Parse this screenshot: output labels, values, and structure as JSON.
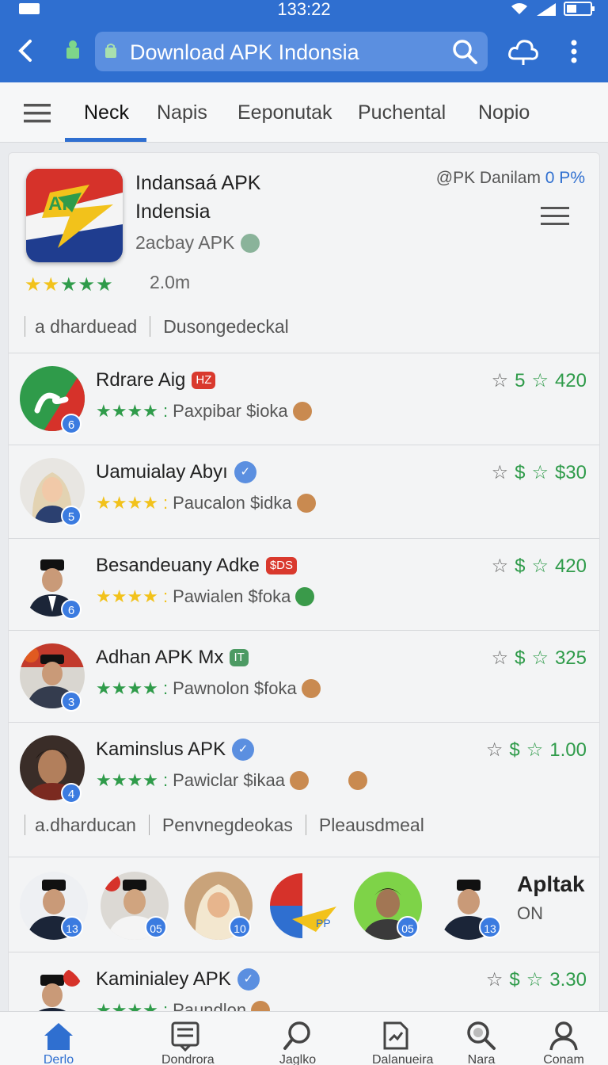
{
  "status_bar": {
    "time": "133:22"
  },
  "app_bar": {
    "url_text": "Download APK Indonsia"
  },
  "tabs": [
    {
      "label": "Neck",
      "active": true
    },
    {
      "label": "Napis",
      "active": false
    },
    {
      "label": "Eeponutak",
      "active": false
    },
    {
      "label": "Puchental",
      "active": false
    },
    {
      "label": "Nopio",
      "active": false
    }
  ],
  "hero": {
    "icon_text": "AF",
    "title_line1": "Indansaá APK",
    "title_line2": "Indensia",
    "subtitle": "2acbay APK",
    "right_label": "@PK Danilam",
    "right_accent": "0 P%",
    "rating_count": "2.0m",
    "chips": [
      "a dharduead",
      "Dusongedeckal"
    ]
  },
  "rows": [
    {
      "title": "Rdrare Aig",
      "badge": "HZ",
      "badge_color": "red",
      "stars_color": "green",
      "sub": "Paxpibar $ioka",
      "coin": "brown",
      "price_prefix": "5",
      "price": "420",
      "avatar_badge": "6"
    },
    {
      "title": "Uamuialay Abyı",
      "badge": "✓",
      "badge_color": "blue",
      "stars_color": "yellow",
      "sub": "Paucalon $idka",
      "coin": "brown",
      "price_prefix": "$",
      "price": "$30",
      "avatar_badge": "5"
    },
    {
      "title": "Besandeuany Adke",
      "badge": "$DS",
      "badge_color": "red",
      "stars_color": "yellow",
      "sub": "Pawialen $foka",
      "coin": "green",
      "price_prefix": "$",
      "price": "420",
      "avatar_badge": "6"
    },
    {
      "title": "Adhan APK Mx",
      "badge": "IT",
      "badge_color": "green",
      "stars_color": "green",
      "sub": "Pawnolon $foka",
      "coin": "brown",
      "price_prefix": "$",
      "price": "325",
      "avatar_badge": "3"
    },
    {
      "title": "Kaminslus APK",
      "badge": "✓",
      "badge_color": "blue",
      "stars_color": "green",
      "sub": "Pawiclar $ikaa",
      "coin": "brown",
      "price_prefix": "$",
      "price": "1.00",
      "avatar_badge": "4"
    }
  ],
  "chips2": [
    "a.dharducan",
    "Penvnegdeokas",
    "Pleausdmeal"
  ],
  "strip": {
    "badges": [
      "13",
      "05",
      "10",
      "",
      "05",
      "13"
    ],
    "label": "Apltak",
    "sub": "ON"
  },
  "last_row": {
    "title": "Kaminialey APK",
    "badge": "✓",
    "sub": "Paundlon",
    "price_prefix": "$",
    "price": "3.30"
  },
  "bottom_nav": [
    {
      "label": "Derlo",
      "icon": "home-icon",
      "active": true
    },
    {
      "label": "Dondrora",
      "icon": "news-icon",
      "active": false
    },
    {
      "label": "Jaglko",
      "icon": "search-icon",
      "active": false
    },
    {
      "label": "Dalanueira",
      "icon": "download-icon",
      "active": false
    },
    {
      "label": "Nara",
      "icon": "magnifier-icon",
      "active": false
    },
    {
      "label": "Conam",
      "icon": "profile-icon",
      "active": false
    }
  ]
}
